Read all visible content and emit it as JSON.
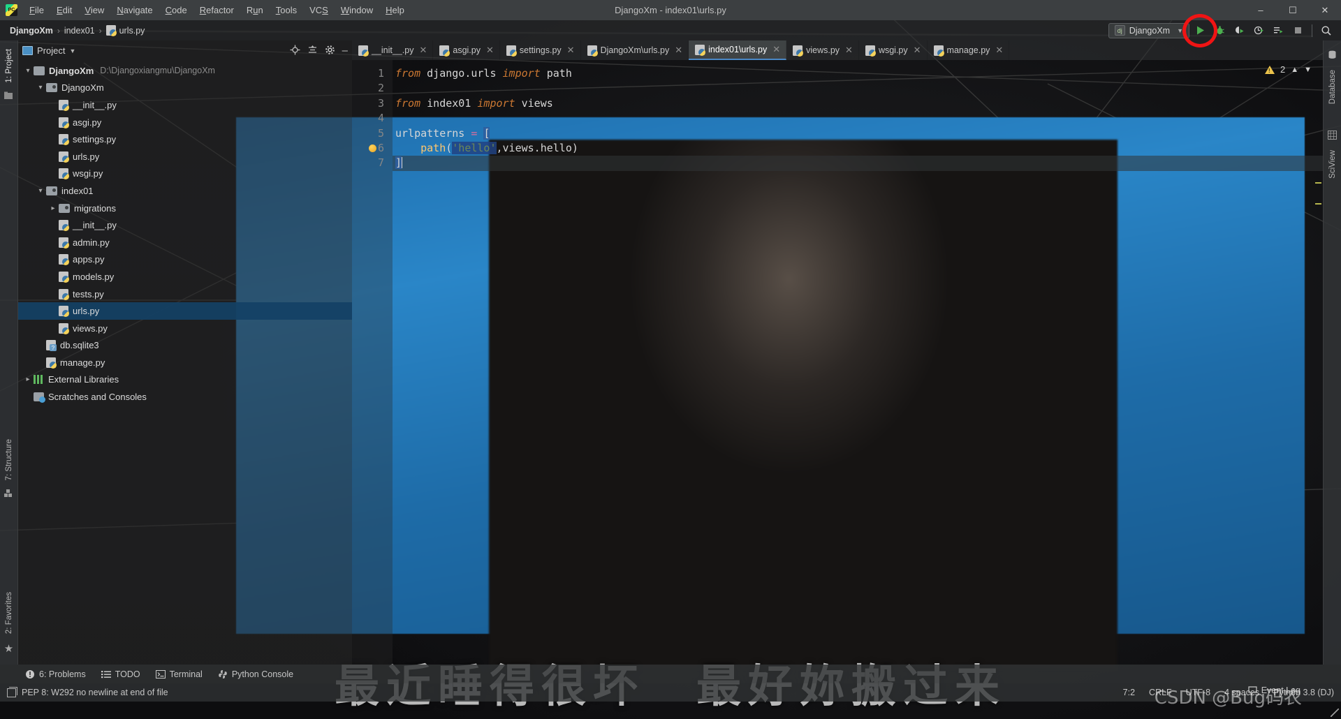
{
  "window": {
    "title": "DjangoXm - index01\\urls.py",
    "logo_icon": "pycharm-logo-icon",
    "minimize_icon": "minimize-icon",
    "maximize_icon": "maximize-icon",
    "close_icon": "close-icon"
  },
  "menubar": {
    "items": [
      {
        "label": "File"
      },
      {
        "label": "Edit"
      },
      {
        "label": "View"
      },
      {
        "label": "Navigate"
      },
      {
        "label": "Code"
      },
      {
        "label": "Refactor"
      },
      {
        "label": "Run"
      },
      {
        "label": "Tools"
      },
      {
        "label": "VCS"
      },
      {
        "label": "Window"
      },
      {
        "label": "Help"
      }
    ]
  },
  "breadcrumb": {
    "project": "DjangoXm",
    "package": "index01",
    "file": "urls.py",
    "separator": "›"
  },
  "run_toolbar": {
    "config_name": "DjangoXm",
    "config_badge": "dj",
    "dropdown_icon": "chevron-down-icon",
    "run_icon": "run-icon",
    "debug_icon": "debug-icon",
    "run_coverage_icon": "run-with-coverage-icon",
    "profile_icon": "profile-icon",
    "run_tests_icon": "run-tests-icon",
    "stop_icon": "stop-icon",
    "search_icon": "search-everywhere-icon",
    "highlight_color": "#f01414"
  },
  "left_strip": {
    "tabs": [
      "1: Project",
      "7: Structure",
      "2: Favorites"
    ],
    "icons": [
      "project-icon",
      "structure-icon",
      "favorites-star-icon"
    ]
  },
  "right_strip": {
    "tabs": [
      "Database",
      "SciView"
    ],
    "icons": [
      "database-icon",
      "sciview-icon"
    ]
  },
  "project_panel": {
    "title": "Project",
    "dropdown_icon": "chevron-down-icon",
    "view_icon": "project-view-icon",
    "tools": [
      "locate-icon",
      "collapse-all-icon",
      "settings-gear-icon",
      "hide-panel-icon"
    ],
    "tree": [
      {
        "label": "DjangoXm",
        "path": "D:\\Djangoxiangmu\\DjangoXm",
        "indent": 0,
        "arrow": "expanded",
        "icon": "folder-icon",
        "bold": true,
        "selected": false
      },
      {
        "label": "DjangoXm",
        "path": "",
        "indent": 1,
        "arrow": "expanded",
        "icon": "module-folder-icon",
        "bold": false,
        "selected": false
      },
      {
        "label": "__init__.py",
        "path": "",
        "indent": 2,
        "arrow": "none",
        "icon": "python-file-icon",
        "bold": false,
        "selected": false
      },
      {
        "label": "asgi.py",
        "path": "",
        "indent": 2,
        "arrow": "none",
        "icon": "python-file-icon",
        "bold": false,
        "selected": false
      },
      {
        "label": "settings.py",
        "path": "",
        "indent": 2,
        "arrow": "none",
        "icon": "python-file-icon",
        "bold": false,
        "selected": false
      },
      {
        "label": "urls.py",
        "path": "",
        "indent": 2,
        "arrow": "none",
        "icon": "python-file-icon",
        "bold": false,
        "selected": false
      },
      {
        "label": "wsgi.py",
        "path": "",
        "indent": 2,
        "arrow": "none",
        "icon": "python-file-icon",
        "bold": false,
        "selected": false
      },
      {
        "label": "index01",
        "path": "",
        "indent": 1,
        "arrow": "expanded",
        "icon": "module-folder-icon",
        "bold": false,
        "selected": false
      },
      {
        "label": "migrations",
        "path": "",
        "indent": 2,
        "arrow": "collapsed",
        "icon": "module-folder-icon",
        "bold": false,
        "selected": false
      },
      {
        "label": "__init__.py",
        "path": "",
        "indent": 2,
        "arrow": "none",
        "icon": "python-file-icon",
        "bold": false,
        "selected": false
      },
      {
        "label": "admin.py",
        "path": "",
        "indent": 2,
        "arrow": "none",
        "icon": "python-file-icon",
        "bold": false,
        "selected": false
      },
      {
        "label": "apps.py",
        "path": "",
        "indent": 2,
        "arrow": "none",
        "icon": "python-file-icon",
        "bold": false,
        "selected": false
      },
      {
        "label": "models.py",
        "path": "",
        "indent": 2,
        "arrow": "none",
        "icon": "python-file-icon",
        "bold": false,
        "selected": false
      },
      {
        "label": "tests.py",
        "path": "",
        "indent": 2,
        "arrow": "none",
        "icon": "python-file-icon",
        "bold": false,
        "selected": false
      },
      {
        "label": "urls.py",
        "path": "",
        "indent": 2,
        "arrow": "none",
        "icon": "python-file-icon",
        "bold": false,
        "selected": true
      },
      {
        "label": "views.py",
        "path": "",
        "indent": 2,
        "arrow": "none",
        "icon": "python-file-icon",
        "bold": false,
        "selected": false
      },
      {
        "label": "db.sqlite3",
        "path": "",
        "indent": 1,
        "arrow": "none",
        "icon": "unknown-file-icon",
        "bold": false,
        "selected": false
      },
      {
        "label": "manage.py",
        "path": "",
        "indent": 1,
        "arrow": "none",
        "icon": "python-file-icon",
        "bold": false,
        "selected": false
      },
      {
        "label": "External Libraries",
        "path": "",
        "indent": 0,
        "arrow": "collapsed",
        "icon": "library-icon",
        "bold": false,
        "selected": false
      },
      {
        "label": "Scratches and Consoles",
        "path": "",
        "indent": 0,
        "arrow": "none",
        "icon": "scratches-icon",
        "bold": false,
        "selected": false
      }
    ]
  },
  "editor_tabs": [
    {
      "label": "__init__.py",
      "active": false
    },
    {
      "label": "asgi.py",
      "active": false
    },
    {
      "label": "settings.py",
      "active": false
    },
    {
      "label": "DjangoXm\\urls.py",
      "active": false
    },
    {
      "label": "index01\\urls.py",
      "active": true
    },
    {
      "label": "views.py",
      "active": false
    },
    {
      "label": "wsgi.py",
      "active": false
    },
    {
      "label": "manage.py",
      "active": false
    }
  ],
  "editor": {
    "line_numbers": [
      "1",
      "2",
      "3",
      "4",
      "5",
      "6",
      "7"
    ],
    "lines": [
      {
        "n": 1,
        "text": "from django.urls import path",
        "fold": true,
        "warn": false
      },
      {
        "n": 2,
        "text": "",
        "fold": false,
        "warn": false
      },
      {
        "n": 3,
        "text": "from index01 import views",
        "fold": true,
        "warn": false
      },
      {
        "n": 4,
        "text": "",
        "fold": false,
        "warn": false
      },
      {
        "n": 5,
        "text": "urlpatterns = [",
        "fold": true,
        "warn": false
      },
      {
        "n": 6,
        "text": "    path('hello',views.hello)",
        "fold": false,
        "warn": true
      },
      {
        "n": 7,
        "text": "]",
        "fold": false,
        "warn": false
      }
    ],
    "inspection": {
      "warning_count": "2",
      "warning_icon": "warning-triangle-icon",
      "prev_icon": "chevron-up-icon",
      "next_icon": "chevron-down-icon"
    }
  },
  "bottom_tools": [
    {
      "label": "6: Problems",
      "icon": "problems-icon"
    },
    {
      "label": "TODO",
      "icon": "todo-icon"
    },
    {
      "label": "Terminal",
      "icon": "terminal-icon"
    },
    {
      "label": "Python Console",
      "icon": "python-console-icon"
    }
  ],
  "statusbar": {
    "message": "PEP 8: W292 no newline at end of file",
    "message_icon": "inspection-icon",
    "caret_position": "7:2",
    "line_separator": "CRLF",
    "encoding": "UTF-8",
    "indent": "4 spaces",
    "interpreter": "Python 3.8 (DJ)",
    "event_log": "Event Log",
    "event_log_icon": "event-log-icon"
  },
  "background": {
    "subtitle": "最近睡得很坏　最好妳搬过来"
  },
  "watermark": "CSDN @Bug码农"
}
